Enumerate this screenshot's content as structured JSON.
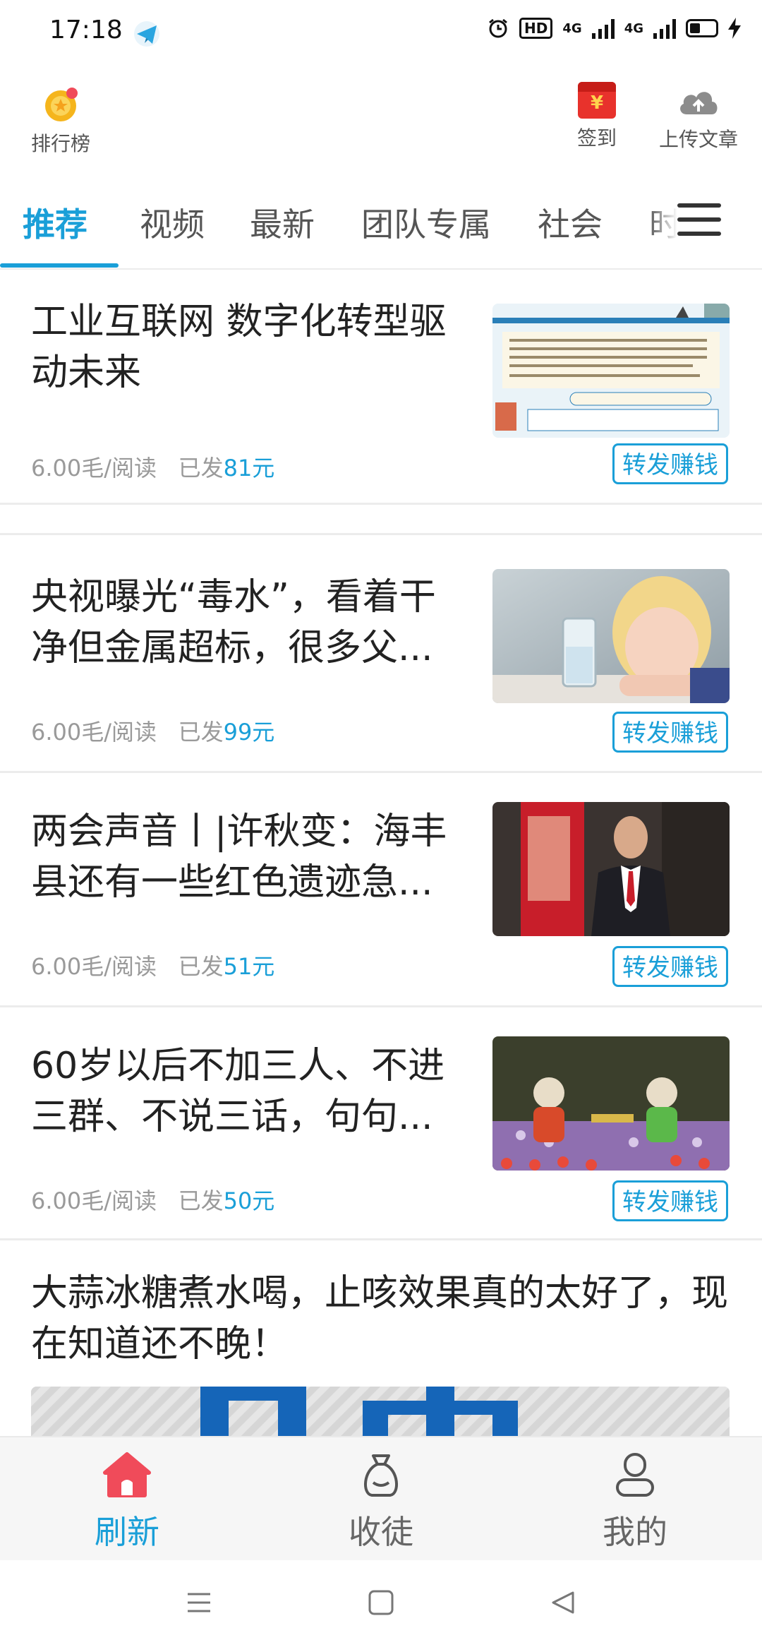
{
  "status_bar": {
    "time": "17:18",
    "hd": "HD",
    "net1": "4G",
    "net2": "4G"
  },
  "header": {
    "rank_label": "排行榜",
    "sign_label": "签到",
    "upload_label": "上传文章",
    "sign_icon_char": "¥"
  },
  "tabs": [
    "推荐",
    "视频",
    "最新",
    "团队专属",
    "社会",
    "时"
  ],
  "active_tab": "推荐",
  "articles": [
    {
      "title": "工业互联网 数字化转型驱动未来",
      "rate": "6.00毛/阅读",
      "sent_prefix": "已发",
      "sent_amount": "81元",
      "share": "转发赚钱"
    },
    {
      "title": "央视曝光“毒水”，看着干净但金属超标，很多父...",
      "rate": "6.00毛/阅读",
      "sent_prefix": "已发",
      "sent_amount": "99元",
      "share": "转发赚钱"
    },
    {
      "title": "两会声音丨|许秋变：海丰县还有一些红色遗迹急...",
      "rate": "6.00毛/阅读",
      "sent_prefix": "已发",
      "sent_amount": "51元",
      "share": "转发赚钱"
    },
    {
      "title": "60岁以后不加三人、不进三群、不说三话，句句...",
      "rate": "6.00毛/阅读",
      "sent_prefix": "已发",
      "sent_amount": "50元",
      "share": "转发赚钱"
    },
    {
      "title": "大蒜冰糖煮水喝，止咳效果真的太好了，现在知道还不晚！"
    }
  ],
  "bottom_nav": {
    "refresh": "刷新",
    "apprentice": "收徒",
    "mine": "我的"
  },
  "colors": {
    "accent": "#1a9fd8",
    "home_icon": "#f04b5a",
    "red_envelope": "#e8322c"
  }
}
